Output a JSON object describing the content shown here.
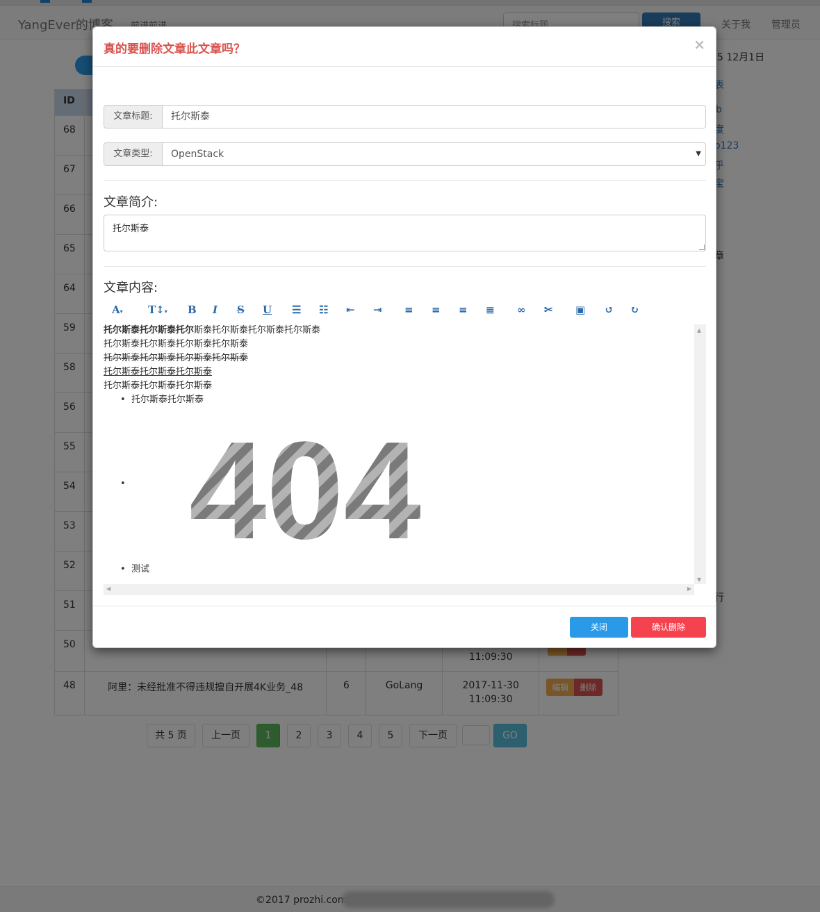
{
  "nav": {
    "brand": "YangEver的博客",
    "subtitle": "前进前进...",
    "search_placeholder": "搜索标题",
    "search_button": "搜索",
    "links": [
      "关于我",
      "管理员"
    ]
  },
  "table": {
    "header_id": "ID",
    "row_ids": [
      "68",
      "67",
      "66",
      "65",
      "64",
      "59",
      "58",
      "56",
      "55",
      "54",
      "53",
      "52",
      "51",
      "50"
    ],
    "row50_time_tail": "11:09:30",
    "last_row": {
      "id": "48",
      "title": "阿里：未经批准不得违规擅自开展4K业务_48",
      "count": "6",
      "type": "GoLang",
      "date": "2017-11-30",
      "time": "11:09:30",
      "edit": "编辑",
      "delete": "删除"
    }
  },
  "sidebar": {
    "date_fragment": "5 12月1日",
    "fragments": [
      "表",
      "b",
      "度",
      "o123",
      "乎",
      "宝",
      "章",
      "行"
    ]
  },
  "pagination": {
    "total": "共 5 页",
    "prev": "上一页",
    "pages": [
      "1",
      "2",
      "3",
      "4",
      "5"
    ],
    "next": "下一页",
    "go": "GO"
  },
  "footer": {
    "copyright": "©2017 prozhi.com 3"
  },
  "modal": {
    "title": "真的要删除文章此文章吗？",
    "close_glyph": "×",
    "title_label": "文章标题:",
    "title_value": "托尔斯泰",
    "type_label": "文章类型:",
    "type_value": "OpenStack",
    "intro_label": "文章简介:",
    "intro_value": "托尔斯泰",
    "content_label": "文章内容:",
    "toolbar_icons": [
      "font-icon",
      "font-size-icon",
      "bold-icon",
      "italic-icon",
      "strikethrough-icon",
      "underline-icon",
      "bullet-list-icon",
      "number-list-icon",
      "outdent-icon",
      "indent-icon",
      "align-left-icon",
      "align-center-icon",
      "align-right-icon",
      "justify-icon",
      "link-icon",
      "unlink-icon",
      "image-icon",
      "undo-icon",
      "redo-icon"
    ],
    "editor": {
      "line1_bold": "托尔斯泰托尔斯泰托尔",
      "line1_rest": "斯泰托尔斯泰托尔斯泰托尔斯泰",
      "line2": "托尔斯泰托尔斯泰托尔斯泰托尔斯泰",
      "line3_strike": "托尔斯泰托尔斯泰托尔斯泰托尔斯泰",
      "line4_underline": "托尔斯泰托尔斯泰托尔斯泰",
      "line5": "托尔斯泰托尔斯泰托尔斯泰",
      "bullet1": "托尔斯泰托尔斯泰",
      "image_text": "404",
      "bullet3": "测试"
    },
    "close_button": "关闭",
    "confirm_button": "确认删除"
  },
  "colors": {
    "danger": "#d9534f",
    "primary": "#2a9ae8",
    "confirm": "#f5424f",
    "success": "#5cb85c",
    "info": "#5bc0de"
  }
}
